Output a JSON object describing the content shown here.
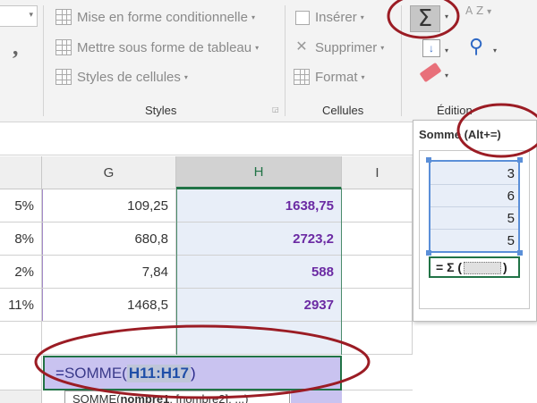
{
  "ribbon": {
    "styles": {
      "conditional_formatting": "Mise en forme conditionnelle",
      "format_as_table": "Mettre sous forme de tableau",
      "cell_styles": "Styles de cellules",
      "group_label": "Styles"
    },
    "cells": {
      "insert": "Insérer",
      "delete": "Supprimer",
      "format": "Format",
      "group_label": "Cellules"
    },
    "editing": {
      "group_label": "Édition",
      "autosum_symbol": "Σ",
      "sort_filter_symbol": "A Z"
    },
    "number": {
      "comma_style": ","
    }
  },
  "tooltip": {
    "title": "Somme (Alt+=)",
    "preview_values": [
      "3",
      "6",
      "5",
      "5"
    ],
    "preview_formula_prefix": "= Σ (",
    "preview_formula_suffix": ")"
  },
  "grid": {
    "columns": [
      {
        "id": "G",
        "label": "G"
      },
      {
        "id": "H",
        "label": "H"
      },
      {
        "id": "I",
        "label": "I"
      }
    ],
    "rows": [
      {
        "f": "5%",
        "g": "109,25",
        "h": "1638,75"
      },
      {
        "f": "8%",
        "g": "680,8",
        "h": "2723,2"
      },
      {
        "f": "2%",
        "g": "7,84",
        "h": "588"
      },
      {
        "f": "11%",
        "g": "1468,5",
        "h": "2937"
      }
    ]
  },
  "formula_cell": {
    "prefix": "=",
    "function": "SOMME(",
    "range": "H11:H17",
    "suffix": ")"
  },
  "hint": {
    "text": "SOMME(",
    "bold": "nombre1",
    "rest": "; [nombre2]; ...)"
  },
  "colors": {
    "ribbon_bg": "#f3f3f3",
    "excel_green": "#217346",
    "selection_blue": "#e8eef8",
    "value_purple": "#6b2aa3",
    "annotation_red": "#9b1c24"
  }
}
